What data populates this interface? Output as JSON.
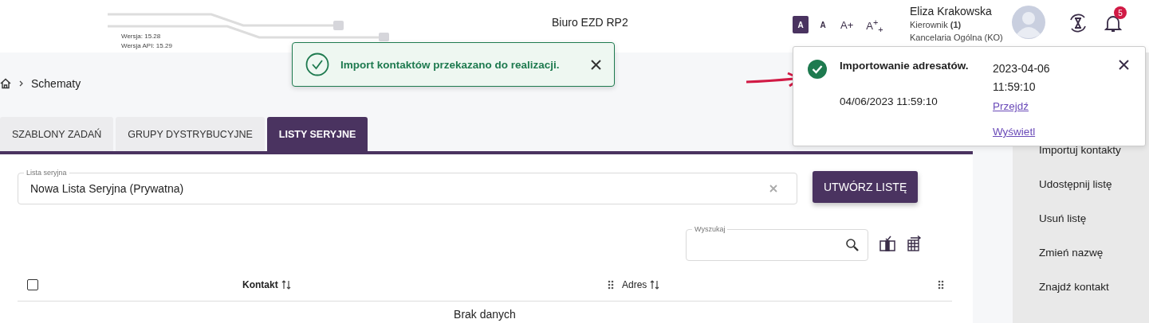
{
  "header": {
    "version": "Wersja: 15.28",
    "api_version": "Wersja API: 15.29",
    "title": "Biuro EZD RP2",
    "font_sizes": [
      {
        "label": "A",
        "selected": true
      },
      {
        "label": "A",
        "selected": false
      },
      {
        "label": "A+",
        "selected": false
      },
      {
        "label": "A$^{+}$$_{+}$",
        "selected": false
      }
    ],
    "user": {
      "name": "Eliza Krakowska",
      "role": "Kierownik **(1)**",
      "unit": "Kancelaria Ogólna (KO)"
    },
    "notification_count": "5"
  },
  "toast": {
    "message": "Import kontaktów przekazano do realizacji."
  },
  "notification": {
    "title": "Importowanie adresatów.",
    "timestamp": "04/06/2023 11:59:10",
    "date": "2023-04-06",
    "time": "11:59:10",
    "links": [
      "Przejdź",
      "Wyświetl"
    ]
  },
  "breadcrumb": [
    "Schematy"
  ],
  "tabs": [
    {
      "label": "SZABLONY ZADAŃ",
      "selected": false
    },
    {
      "label": "GRUPY DYSTRYBUCYJNE",
      "selected": false
    },
    {
      "label": "LISTY SERYJNE",
      "selected": true
    }
  ],
  "list_field": {
    "label": "Lista seryjna",
    "value": "Nowa Lista Seryjna (Prywatna)"
  },
  "create_button": "UTWÓRZ LISTĘ",
  "search": {
    "label": "Wyszukaj"
  },
  "table": {
    "select_all_checked": false,
    "columns": [
      "Kontakt",
      "Adres"
    ],
    "empty_text": "Brak danych"
  },
  "side_menu": [
    "Importuj kontakty",
    "Udostępnij listę",
    "Usuń listę",
    "Zmień nazwę",
    "Znajdź kontakt"
  ]
}
